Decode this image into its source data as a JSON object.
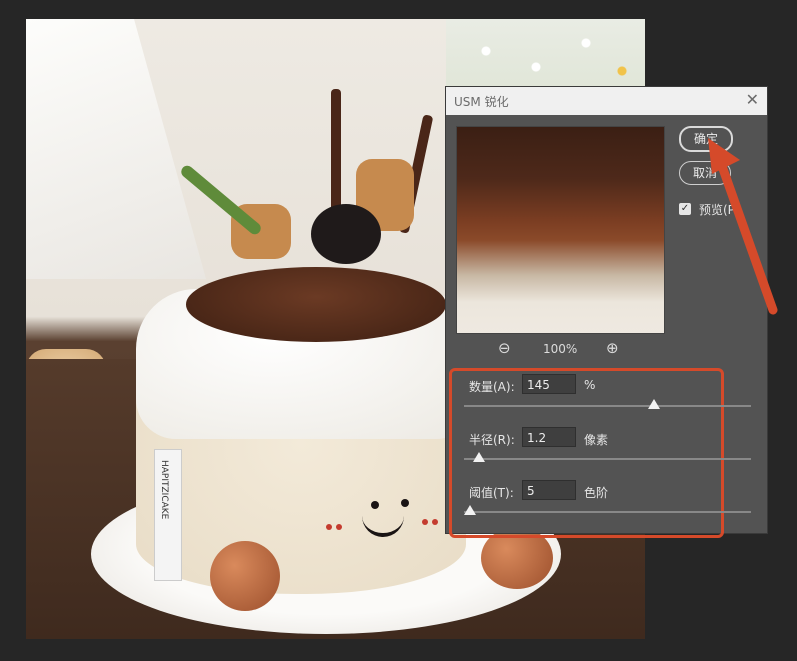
{
  "dialog": {
    "title": "USM 锐化",
    "ok_label": "确定",
    "cancel_label": "取消",
    "preview_label": "预览(P)",
    "preview_checked": true,
    "zoom_level": "100%",
    "params": [
      {
        "label": "数量(A):",
        "value": "145",
        "unit": "%",
        "slider_fraction": 0.66
      },
      {
        "label": "半径(R):",
        "value": "1.2",
        "unit": "像素",
        "slider_fraction": 0.05
      },
      {
        "label": "阈值(T):",
        "value": "5",
        "unit": "色阶",
        "slider_fraction": 0.02
      }
    ]
  },
  "canvas": {
    "tag_text": "HAPITZICAKE"
  },
  "colors": {
    "annotation": "#d54a2a",
    "dialog_bg": "#535353"
  },
  "icons": {
    "close": "close-icon",
    "zoom_out": "zoom-out-icon",
    "zoom_in": "zoom-in-icon",
    "check": "checkbox-check-icon"
  }
}
